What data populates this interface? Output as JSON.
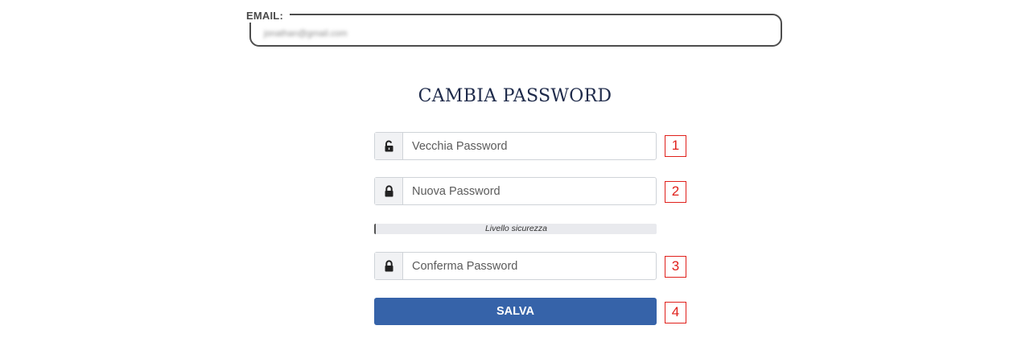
{
  "email": {
    "label": "EMAIL:",
    "value": "jonathan@gmail.com"
  },
  "title": "CAMBIA PASSWORD",
  "fields": {
    "old_password": {
      "placeholder": "Vecchia Password",
      "icon": "unlock-icon"
    },
    "new_password": {
      "placeholder": "Nuova Password",
      "icon": "lock-icon"
    },
    "confirm_password": {
      "placeholder": "Conferma Password",
      "icon": "lock-icon"
    }
  },
  "strength": {
    "label": "Livello sicurezza",
    "level": 0
  },
  "save_button": {
    "label": "SALVA"
  },
  "markers": [
    "1",
    "2",
    "3",
    "4"
  ],
  "colors": {
    "button": "#3663a9",
    "marker": "#e0201b",
    "title": "#1e2a4a"
  }
}
